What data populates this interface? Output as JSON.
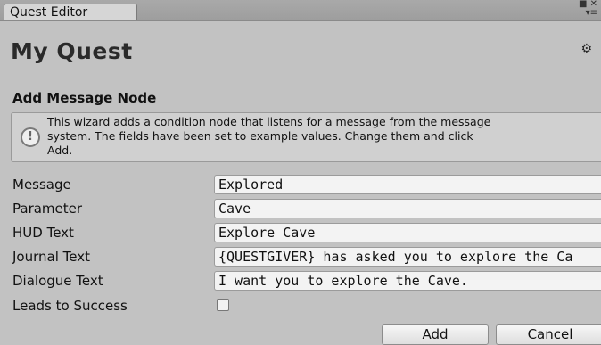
{
  "window": {
    "tab_label": "Quest Editor",
    "icons": [
      "window-maximize-icon",
      "close-icon",
      "tab-menu-icon"
    ]
  },
  "header": {
    "title": "My Quest",
    "settings_icon": "gear-icon"
  },
  "wizard": {
    "section_title": "Add Message Node",
    "help_icon": "info-icon",
    "help_text": "This wizard adds a condition node that listens for a message from the message\nsystem. The fields have been set to example values. Change them and click\nAdd.",
    "fields": {
      "message": {
        "label": "Message",
        "value": "Explored"
      },
      "parameter": {
        "label": "Parameter",
        "value": "Cave"
      },
      "hud_text": {
        "label": "HUD Text",
        "value": "Explore Cave"
      },
      "journal_text": {
        "label": "Journal Text",
        "value": "{QUESTGIVER} has asked you to explore the Ca"
      },
      "dialogue_text": {
        "label": "Dialogue Text",
        "value": "I want you to explore the Cave."
      },
      "leads_to_success": {
        "label": "Leads to Success",
        "checked": false
      }
    },
    "buttons": {
      "add": "Add",
      "cancel": "Cancel"
    }
  }
}
